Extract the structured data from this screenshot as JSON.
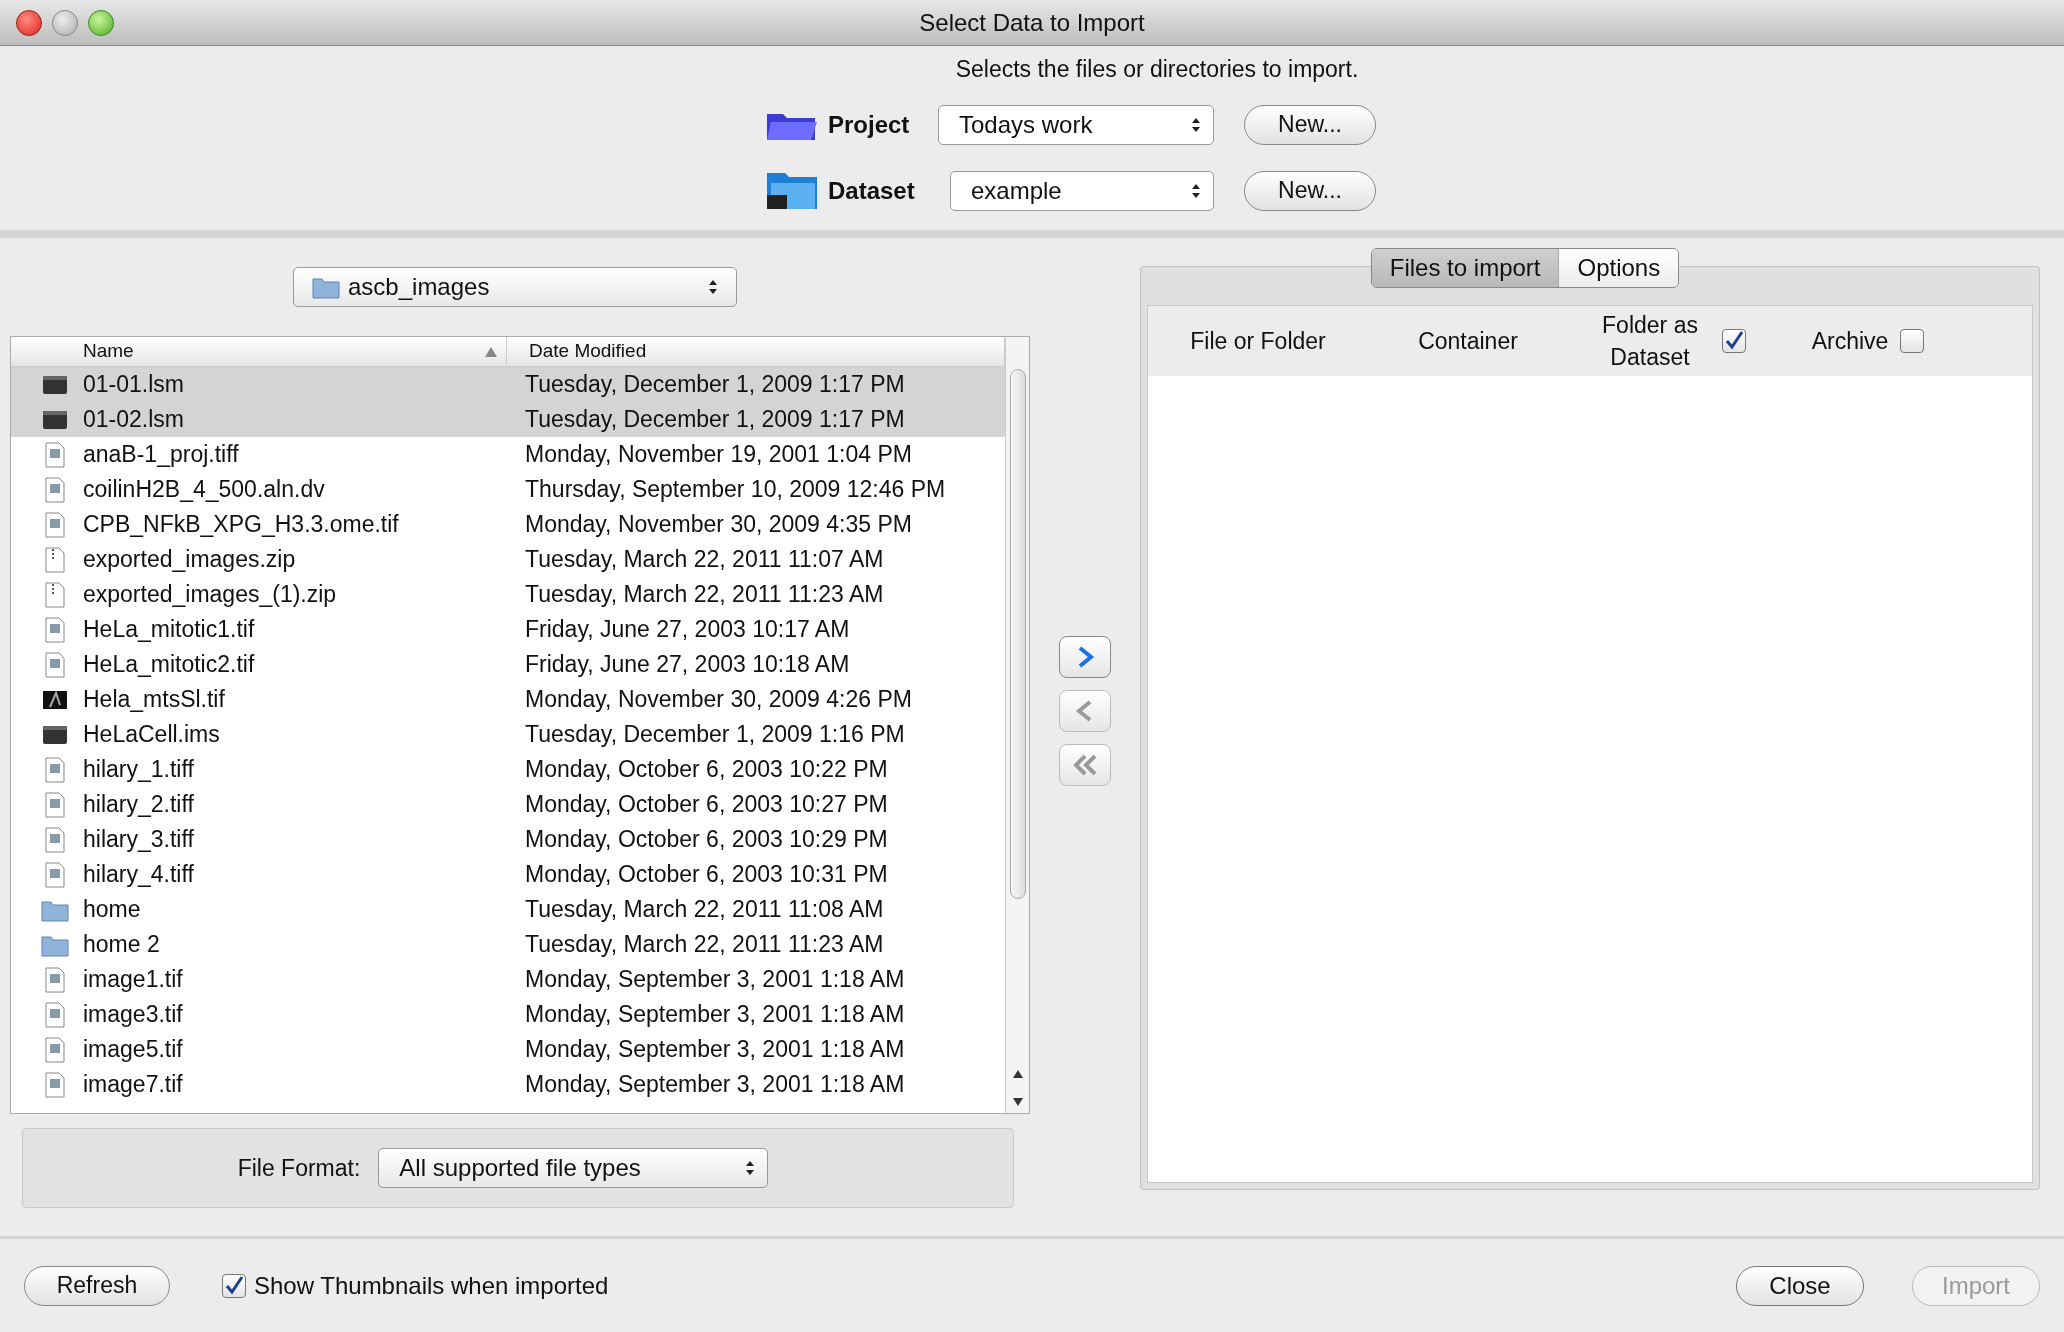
{
  "window": {
    "title": "Select Data to Import"
  },
  "header": {
    "description": "Selects the files or directories to import.",
    "fields": [
      {
        "kind": "project",
        "label": "Project",
        "value": "Todays work",
        "button": "New..."
      },
      {
        "kind": "dataset",
        "label": "Dataset",
        "value": "example",
        "button": "New..."
      }
    ]
  },
  "browser": {
    "folder": "ascb_images",
    "columns": [
      {
        "label": "Name",
        "sorted": true
      },
      {
        "label": "Date Modified",
        "sorted": false
      }
    ],
    "rows": [
      {
        "name": "01-01.lsm",
        "date": "Tuesday, December 1, 2009 1:17 PM",
        "kind": "dark",
        "selected": true
      },
      {
        "name": "01-02.lsm",
        "date": "Tuesday, December 1, 2009 1:17 PM",
        "kind": "dark",
        "selected": true
      },
      {
        "name": "anaB-1_proj.tiff",
        "date": "Monday, November 19, 2001 1:04 PM",
        "kind": "image",
        "selected": false
      },
      {
        "name": "coilinH2B_4_500.aln.dv",
        "date": "Thursday, September 10, 2009 12:46 PM",
        "kind": "image",
        "selected": false
      },
      {
        "name": "CPB_NFkB_XPG_H3.3.ome.tif",
        "date": "Monday, November 30, 2009 4:35 PM",
        "kind": "image",
        "selected": false
      },
      {
        "name": "exported_images.zip",
        "date": "Tuesday, March 22, 2011 11:07 AM",
        "kind": "zip",
        "selected": false
      },
      {
        "name": "exported_images_(1).zip",
        "date": "Tuesday, March 22, 2011 11:23 AM",
        "kind": "zip",
        "selected": false
      },
      {
        "name": "HeLa_mitotic1.tif",
        "date": "Friday, June 27, 2003 10:17 AM",
        "kind": "image",
        "selected": false
      },
      {
        "name": "HeLa_mitotic2.tif",
        "date": "Friday, June 27, 2003 10:18 AM",
        "kind": "image",
        "selected": false
      },
      {
        "name": "Hela_mtsSl.tif",
        "date": "Monday, November 30, 2009 4:26 PM",
        "kind": "thumb",
        "selected": false
      },
      {
        "name": "HeLaCell.ims",
        "date": "Tuesday, December 1, 2009 1:16 PM",
        "kind": "dark",
        "selected": false
      },
      {
        "name": "hilary_1.tiff",
        "date": "Monday, October 6, 2003 10:22 PM",
        "kind": "image",
        "selected": false
      },
      {
        "name": "hilary_2.tiff",
        "date": "Monday, October 6, 2003 10:27 PM",
        "kind": "image",
        "selected": false
      },
      {
        "name": "hilary_3.tiff",
        "date": "Monday, October 6, 2003 10:29 PM",
        "kind": "image",
        "selected": false
      },
      {
        "name": "hilary_4.tiff",
        "date": "Monday, October 6, 2003 10:31 PM",
        "kind": "image",
        "selected": false
      },
      {
        "name": "home",
        "date": "Tuesday, March 22, 2011 11:08 AM",
        "kind": "folder",
        "selected": false
      },
      {
        "name": "home 2",
        "date": "Tuesday, March 22, 2011 11:23 AM",
        "kind": "folder",
        "selected": false
      },
      {
        "name": "image1.tif",
        "date": "Monday, September 3, 2001 1:18 AM",
        "kind": "image",
        "selected": false
      },
      {
        "name": "image3.tif",
        "date": "Monday, September 3, 2001 1:18 AM",
        "kind": "image",
        "selected": false
      },
      {
        "name": "image5.tif",
        "date": "Monday, September 3, 2001 1:18 AM",
        "kind": "image",
        "selected": false
      },
      {
        "name": "image7.tif",
        "date": "Monday, September 3, 2001 1:18 AM",
        "kind": "image",
        "selected": false
      }
    ],
    "file_format": {
      "label": "File Format:",
      "value": "All supported file types"
    }
  },
  "transfer_buttons": [
    {
      "kind": "add",
      "disabled": false
    },
    {
      "kind": "remove",
      "disabled": true
    },
    {
      "kind": "remove_all",
      "disabled": true
    }
  ],
  "import_panel": {
    "tabs": [
      {
        "label": "Files to import",
        "selected": true
      },
      {
        "label": "Options",
        "selected": false
      }
    ],
    "columns": [
      {
        "label": "File or Folder",
        "kind": "text"
      },
      {
        "label": "Container",
        "kind": "text"
      },
      {
        "label": "Folder as Dataset",
        "kind": "checkbox",
        "checked": true
      },
      {
        "label": "Archive",
        "kind": "checkbox",
        "checked": false
      }
    ]
  },
  "footer": {
    "refresh": "Refresh",
    "thumbnails": {
      "label": "Show Thumbnails when imported",
      "checked": true
    },
    "buttons": [
      {
        "label": "Close",
        "disabled": false
      },
      {
        "label": "Import",
        "disabled": true
      }
    ]
  }
}
